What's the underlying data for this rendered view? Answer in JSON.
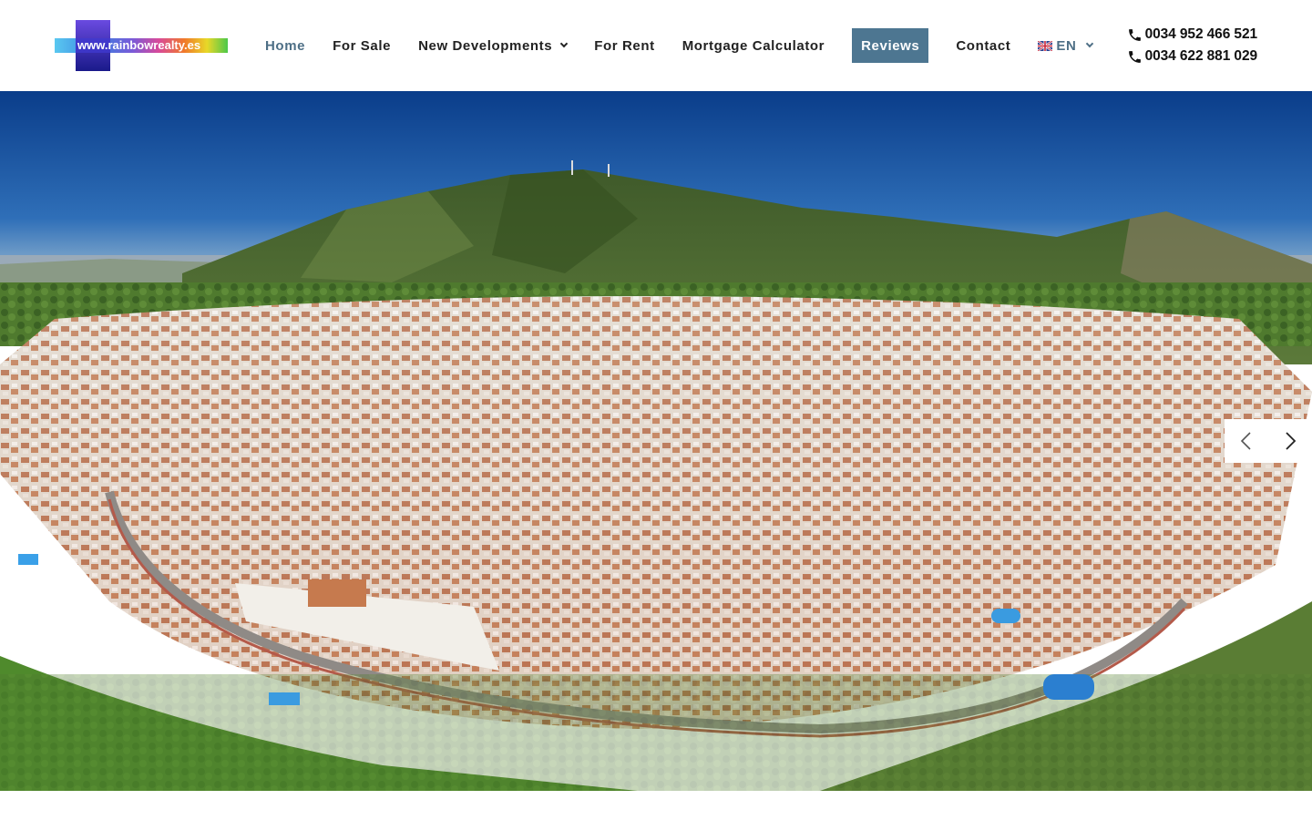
{
  "logo": {
    "text": "www.rainbowrealty.es"
  },
  "nav": {
    "items": [
      {
        "label": "Home",
        "active": true
      },
      {
        "label": "For Sale"
      },
      {
        "label": "New Developments",
        "dropdown": true
      },
      {
        "label": "For Rent"
      },
      {
        "label": "Mortgage Calculator"
      },
      {
        "label": "Reviews",
        "highlighted": true
      },
      {
        "label": "Contact"
      }
    ],
    "language": {
      "label": "EN",
      "flag": "uk-flag-icon"
    }
  },
  "contact": {
    "phones": [
      "0034 952 466 521",
      "0034 622 881 029"
    ],
    "icon": "phone-icon"
  },
  "slider": {
    "image": "aerial view of white hillside village below green mountains",
    "prev_icon": "chevron-left-icon",
    "next_icon": "chevron-right-icon"
  },
  "colors": {
    "active_nav": "#4e6f86",
    "highlight_button": "#4d7691",
    "text": "#222222"
  }
}
